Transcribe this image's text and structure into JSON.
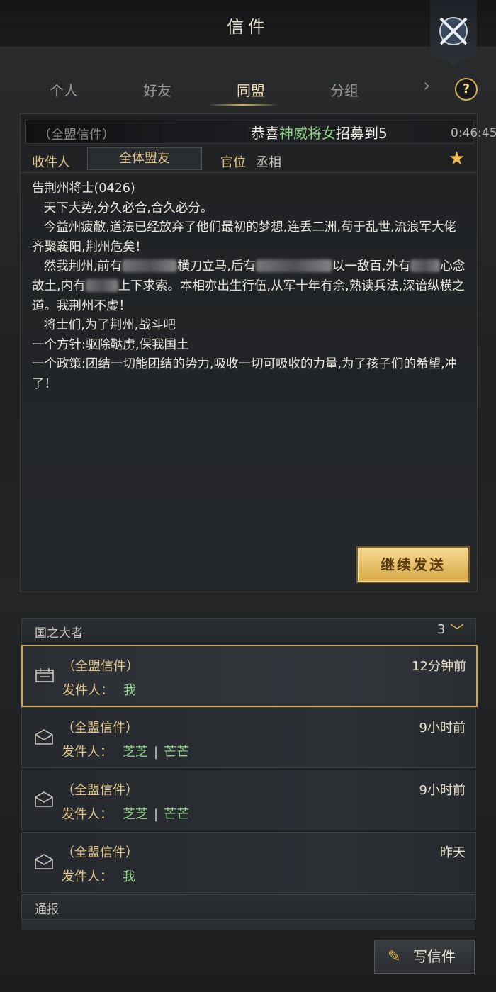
{
  "window": {
    "title": "信件"
  },
  "tabs": [
    "个人",
    "好友",
    "同盟",
    "分组"
  ],
  "active_tab": "同盟",
  "help_label": "?",
  "mail": {
    "header_title": "（全盟信件）",
    "marquee": {
      "prefix": "恭喜",
      "highlight": "神威将女",
      "suffix": "招募到5"
    },
    "header_time": "0:46:45",
    "recipient_label": "收件人",
    "recipient_value": "全体盟友",
    "rank_label": "官位",
    "rank_value": "丞相",
    "body": {
      "line1": "告荆州将士(0426)",
      "line2": "   天下大势,分久必合,合久必分。",
      "line3": "   今益州疲敝,道法已经放弃了他们最初的梦想,连丢二洲,苟于乱世,流浪军大佬齐聚襄阳,荆州危矣！",
      "line4a": "   然我荆州,前有",
      "line4b": "横刀立马,后有",
      "line4c": "以一敌百,外有",
      "line4d": "心念故土,内有",
      "line4e": "上下求索。本相亦出生行伍,从军十年有余,熟读兵法,深谙纵横之道。我荆州不虚！",
      "line5": "   将士们,为了荆州,战斗吧",
      "line6": "一个方针:驱除鞑虏,保我国土",
      "line7": "一个政策:团结一切能团结的势力,吸收一切可吸收的力量,为了孩子们的希望,冲了！"
    },
    "continue_button": "继续发送"
  },
  "group": {
    "title": "国之大者",
    "count": "3"
  },
  "mail_list": [
    {
      "title": "（全盟信件）",
      "time": "12分钟前",
      "sender_label": "发件人：",
      "sender": "我",
      "sender2": "",
      "icon": "calendar-icon"
    },
    {
      "title": "（全盟信件）",
      "time": "9小时前",
      "sender_label": "发件人：",
      "sender": "芝芝",
      "sender2": "芒芒",
      "icon": "envelope-icon"
    },
    {
      "title": "（全盟信件）",
      "time": "9小时前",
      "sender_label": "发件人：",
      "sender": "芝芝",
      "sender2": "芒芒",
      "icon": "envelope-icon"
    },
    {
      "title": "（全盟信件）",
      "time": "昨天",
      "sender_label": "发件人：",
      "sender": "我",
      "sender2": "",
      "icon": "envelope-icon"
    }
  ],
  "report_section": {
    "title": "通报"
  },
  "write_button": "写信件",
  "colors": {
    "accent_gold": "#e2c88e",
    "green_name": "#8fd28a",
    "star": "#f2c04a"
  }
}
